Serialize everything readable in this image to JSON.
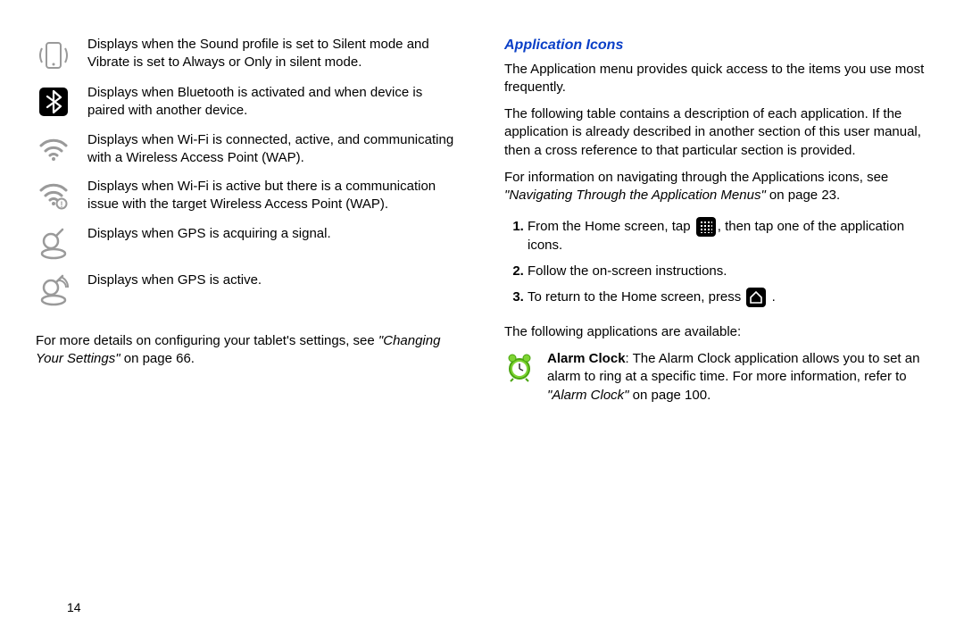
{
  "left": {
    "icons": [
      {
        "name": "vibrate-icon",
        "text": "Displays when the Sound profile is set to Silent mode and Vibrate is set to Always or Only in silent mode."
      },
      {
        "name": "bluetooth-icon",
        "text": "Displays when Bluetooth is activated and when device is paired with another device."
      },
      {
        "name": "wifi-connected-icon",
        "text": "Displays when Wi-Fi is connected, active, and communicating with a Wireless Access Point (WAP)."
      },
      {
        "name": "wifi-issue-icon",
        "text": "Displays when Wi-Fi is active but there is a communication issue with the target Wireless Access Point (WAP)."
      },
      {
        "name": "gps-acquiring-icon",
        "text": "Displays when GPS is acquiring a signal."
      },
      {
        "name": "gps-active-icon",
        "text": "Displays when GPS is active."
      }
    ],
    "footer_pre": "For more details on configuring your tablet's settings, see ",
    "footer_link": "\"Changing Your Settings\"",
    "footer_post": " on page 66."
  },
  "right": {
    "heading": "Application Icons",
    "p1": "The Application menu provides quick access to the items you use most frequently.",
    "p2": "The following table contains a description of each application. If the application is already described in another section of this user manual, then a cross reference to that particular section is provided.",
    "p3_pre": "For information on navigating through the Applications icons, see ",
    "p3_link": "\"Navigating Through the Application Menus\"",
    "p3_post": " on page 23.",
    "step1_pre": "From the Home screen, tap ",
    "step1_post": ", then tap one of the application icons.",
    "step2": "Follow the on-screen instructions.",
    "step3_pre": "To return to the Home screen, press ",
    "step3_post": " .",
    "p4": "The following applications are available:",
    "alarm_bold": "Alarm Clock",
    "alarm_text1": ": The Alarm Clock application allows you to set an alarm to ring at a specific time. For more information, refer to ",
    "alarm_link": "\"Alarm Clock\"",
    "alarm_text2": "  on page 100."
  },
  "page_number": "14"
}
